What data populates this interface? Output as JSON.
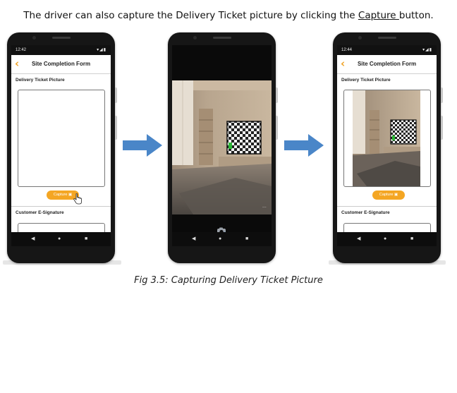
{
  "intro": {
    "text_before": "The driver can also capture the Delivery Ticket picture by clicking the ",
    "link": "Capture ",
    "text_after": "button."
  },
  "caption": "Fig 3.5: Capturing Delivery Ticket Picture",
  "phones": [
    {
      "time": "12:42",
      "title": "Site Completion Form",
      "delivery_label": "Delivery Ticket Picture",
      "capture_label": "Capture",
      "signature_label": "Customer E-Signature"
    },
    {
      "time": ""
    },
    {
      "time": "12:44",
      "title": "Site Completion Form",
      "delivery_label": "Delivery Ticket Picture",
      "capture_label": "Capture",
      "signature_label": "Customer E-Signature"
    }
  ],
  "colors": {
    "accent": "#f4a623",
    "arrow": "#4a86c8",
    "phone_frame": "#161616"
  },
  "icons": {
    "back": "chevron-left-icon",
    "camera": "camera-icon",
    "hand": "hand-pointer-icon",
    "arrow": "arrow-right-icon"
  }
}
